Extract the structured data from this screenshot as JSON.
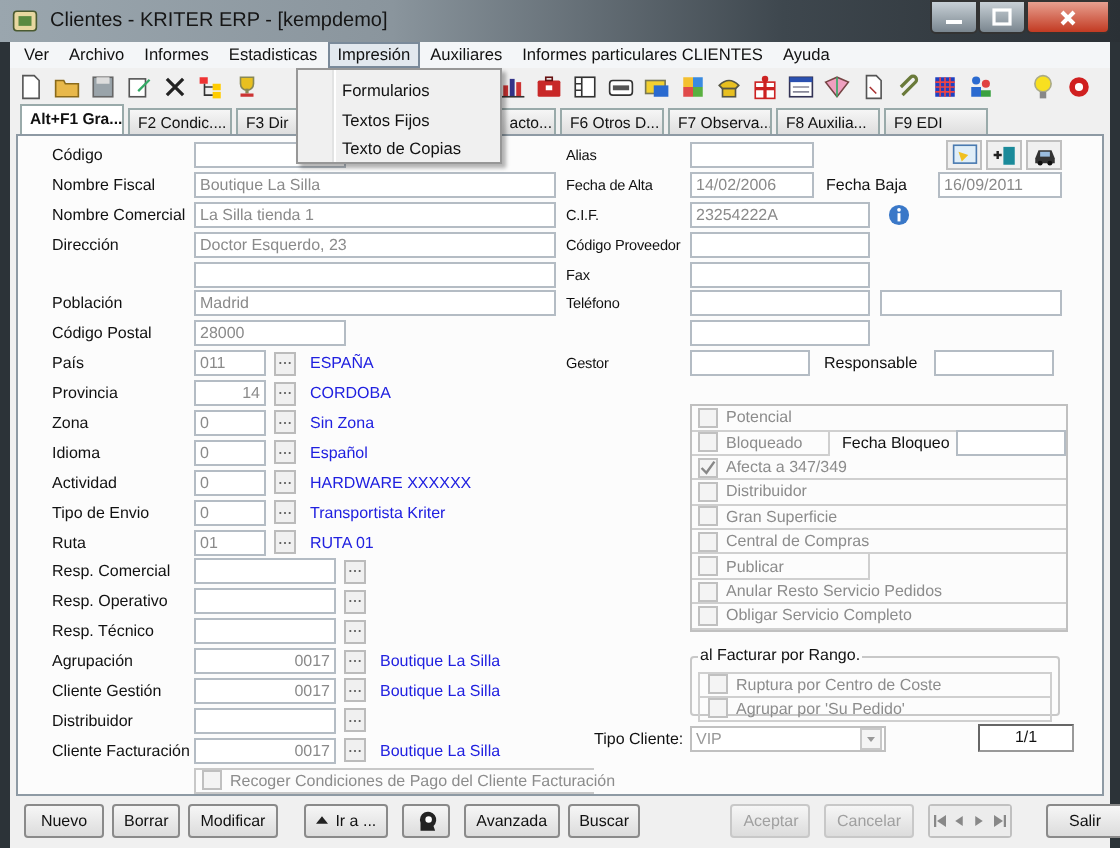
{
  "window": {
    "title": "Clientes - KRITER ERP - [kempdemo]"
  },
  "menu": [
    {
      "label": "Ver",
      "open": false
    },
    {
      "label": "Archivo",
      "open": false
    },
    {
      "label": "Informes",
      "open": false
    },
    {
      "label": "Estadisticas",
      "open": false
    },
    {
      "label": "Impresión",
      "open": true
    },
    {
      "label": "Auxiliares",
      "open": false
    },
    {
      "label": "Informes particulares CLIENTES",
      "open": false
    },
    {
      "label": "Ayuda",
      "open": false
    }
  ],
  "dropdown": {
    "items": [
      "Formularios",
      "Textos Fijos",
      "Texto de Copias"
    ]
  },
  "tabs": [
    {
      "label": "Alt+F1 Gra...",
      "cut_start": false,
      "selected": true
    },
    {
      "label": "F2 Condic....",
      "cut_start": false,
      "selected": false
    },
    {
      "label": "F3 Dir",
      "cut_start": false,
      "selected": false
    },
    {
      "label": "acto...",
      "cut_start": true,
      "selected": false
    },
    {
      "label": "F6 Otros D...",
      "cut_start": false,
      "selected": false
    },
    {
      "label": "F7 Observa...",
      "cut_start": false,
      "selected": false
    },
    {
      "label": "F8 Auxilia...",
      "cut_start": false,
      "selected": false
    },
    {
      "label": "F9 EDI",
      "cut_start": false,
      "selected": false
    }
  ],
  "left": [
    {
      "kind": "short",
      "label": "Código"
    },
    {
      "kind": "text",
      "label": "Nombre Fiscal",
      "value": "Boutique La Silla"
    },
    {
      "kind": "text",
      "label": "Nombre Comercial",
      "value": "La Silla tienda 1"
    },
    {
      "kind": "text",
      "label": "Dirección",
      "value": "Doctor Esquerdo, 23"
    },
    {
      "kind": "text"
    },
    {
      "kind": "text",
      "label": "Población",
      "value": "Madrid"
    },
    {
      "kind": "short",
      "label": "Código Postal",
      "value": "28000"
    },
    {
      "kind": "code",
      "label": "País",
      "value": "011",
      "description": "ESPAÑA"
    },
    {
      "kind": "code_right",
      "label": "Provincia",
      "value": "14",
      "description": "CORDOBA"
    },
    {
      "kind": "code",
      "label": "Zona",
      "value": "0",
      "description": "Sin Zona"
    },
    {
      "kind": "code",
      "label": "Idioma",
      "value": "0",
      "description": "Español"
    },
    {
      "kind": "code",
      "label": "Actividad",
      "value": "0",
      "description": "HARDWARE XXXXXX"
    },
    {
      "kind": "code",
      "label": "Tipo de Envio",
      "value": "0",
      "description": "Transportista Kriter"
    },
    {
      "kind": "code",
      "label": "Ruta",
      "value": "01",
      "description": "RUTA 01"
    },
    {
      "kind": "ref",
      "label": "Resp. Comercial"
    },
    {
      "kind": "ref",
      "label": "Resp. Operativo"
    },
    {
      "kind": "ref",
      "label": "Resp. Técnico"
    },
    {
      "kind": "ref",
      "label": "Agrupación",
      "value": "0017",
      "description": "Boutique La Silla"
    },
    {
      "kind": "ref",
      "label": "Cliente Gestión",
      "value": "0017",
      "description": "Boutique La Silla"
    },
    {
      "kind": "ref",
      "label": "Distribuidor"
    },
    {
      "kind": "ref",
      "label": "Cliente Facturación",
      "value": "0017",
      "description": "Boutique La Silla"
    },
    {
      "kind": "check",
      "label": "Recoger Condiciones de Pago del Cliente Facturación",
      "checked": false,
      "disabled": true
    }
  ],
  "right": {
    "alias": {
      "label": "Alias"
    },
    "fecha_alta": {
      "label": "Fecha de Alta",
      "value": "14/02/2006"
    },
    "fecha_baja": {
      "label": "Fecha Baja",
      "value": "16/09/2011"
    },
    "cif": {
      "label": "C.I.F.",
      "value": "23254222A"
    },
    "codigo_proveedor": {
      "label": "Código Proveedor"
    },
    "fax": {
      "label": "Fax"
    },
    "telefono": {
      "label": "Teléfono"
    },
    "gestor": {
      "label": "Gestor"
    },
    "responsable": {
      "label": "Responsable"
    }
  },
  "flags": [
    {
      "kind": "wide",
      "label": "Potencial",
      "checked": false,
      "disabled": true
    },
    {
      "kind": "dated",
      "label": "Bloqueado",
      "checked": false,
      "disabled": true,
      "date_label": "Fecha Bloqueo"
    },
    {
      "kind": "wide",
      "label": "Afecta a 347/349",
      "checked": true,
      "disabled": true
    },
    {
      "kind": "wide",
      "label": "Distribuidor",
      "checked": false,
      "disabled": true
    },
    {
      "kind": "wide",
      "label": "Gran Superficie",
      "checked": false,
      "disabled": true
    },
    {
      "kind": "wide",
      "label": "Central de Compras",
      "checked": false,
      "disabled": true
    },
    {
      "kind": "short",
      "label": "Publicar",
      "checked": false,
      "disabled": true
    },
    {
      "kind": "wide",
      "label": "Anular Resto Servicio Pedidos",
      "checked": false,
      "disabled": true
    },
    {
      "kind": "wide",
      "label": "Obligar Servicio Completo",
      "checked": false,
      "disabled": true
    }
  ],
  "billing_group": {
    "title": "al Facturar por Rango.",
    "options": [
      {
        "label": "Ruptura por Centro de Coste",
        "checked": false,
        "disabled": true
      },
      {
        "label": "Agrupar por 'Su Pedido'",
        "checked": false,
        "disabled": true
      }
    ]
  },
  "tipo_cliente": {
    "label": "Tipo Cliente:",
    "value": "VIP"
  },
  "record_counter": "1/1",
  "button_groups": [
    [
      {
        "kind": "text",
        "label": "Nuevo",
        "disabled": false
      },
      {
        "kind": "text",
        "label": "Borrar",
        "disabled": false
      },
      {
        "kind": "text",
        "label": "Modificar",
        "disabled": false
      }
    ],
    [
      {
        "kind": "goto",
        "label": "Ir a ...",
        "disabled": false
      },
      {
        "kind": "icon",
        "disabled": false
      }
    ],
    [
      {
        "kind": "text",
        "label": "Avanzada",
        "disabled": false
      },
      {
        "kind": "text",
        "label": "Buscar",
        "disabled": false
      }
    ],
    [
      {
        "kind": "text",
        "label": "Aceptar",
        "disabled": true
      },
      {
        "kind": "text",
        "label": "Cancelar",
        "disabled": true
      },
      {
        "kind": "nav"
      }
    ],
    [
      {
        "kind": "text",
        "label": "Salir",
        "disabled": false
      }
    ]
  ]
}
